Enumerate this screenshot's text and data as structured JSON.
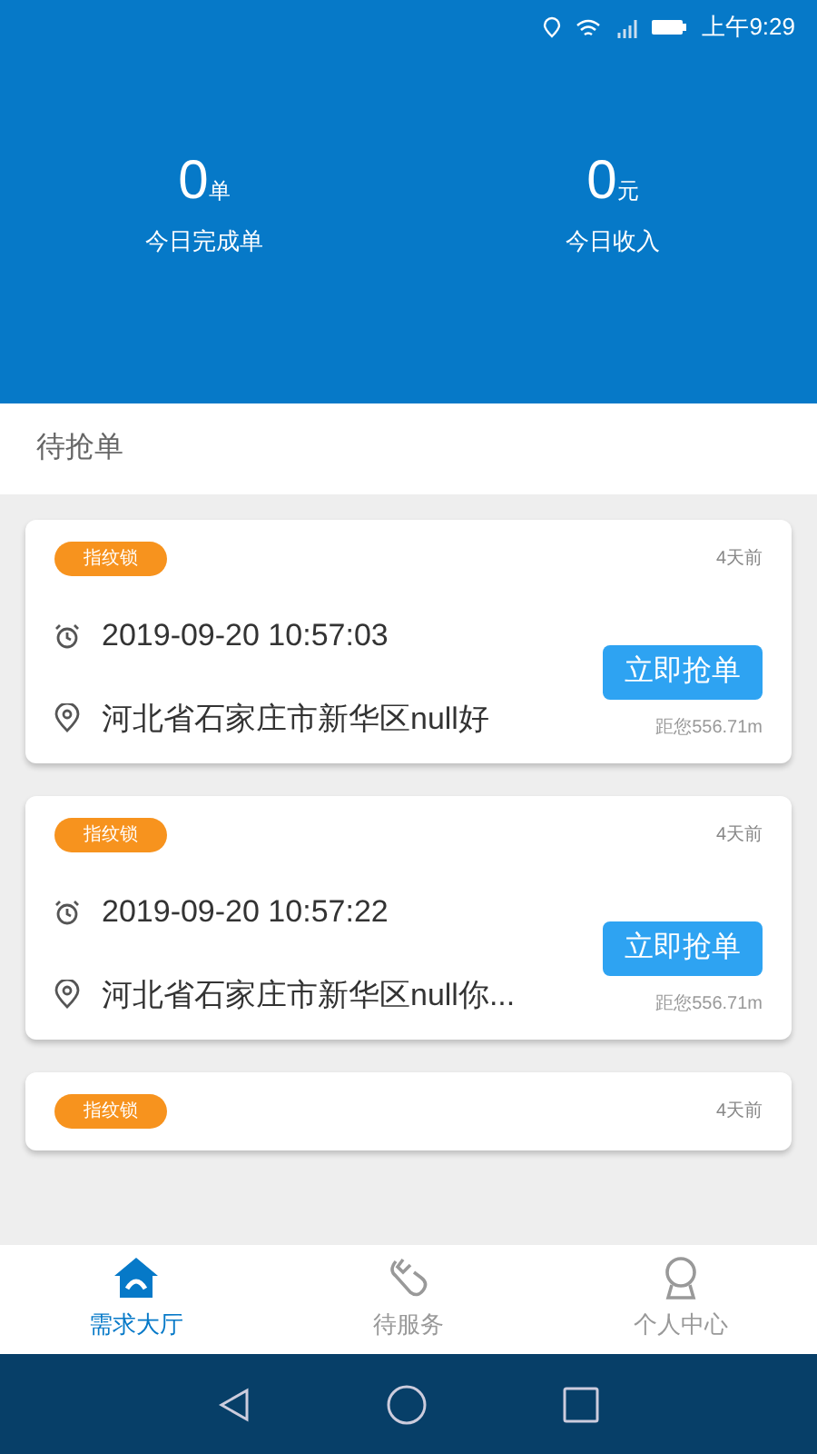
{
  "status_bar": {
    "time": "上午9:29"
  },
  "stats": [
    {
      "value": "0",
      "unit": "单",
      "label": "今日完成单"
    },
    {
      "value": "0",
      "unit": "元",
      "label": "今日收入"
    }
  ],
  "section_title": "待抢单",
  "orders": [
    {
      "tag": "指纹锁",
      "age": "4天前",
      "time": "2019-09-20 10:57:03",
      "address": "河北省石家庄市新华区null好",
      "button": "立即抢单",
      "distance": "距您556.71m"
    },
    {
      "tag": "指纹锁",
      "age": "4天前",
      "time": "2019-09-20 10:57:22",
      "address": "河北省石家庄市新华区null你...",
      "button": "立即抢单",
      "distance": "距您556.71m"
    },
    {
      "tag": "指纹锁",
      "age": "4天前"
    }
  ],
  "tabs": [
    {
      "label": "需求大厅",
      "kind": "home",
      "selected": true
    },
    {
      "label": "待服务",
      "kind": "service",
      "selected": false
    },
    {
      "label": "个人中心",
      "kind": "profile",
      "selected": false
    }
  ]
}
